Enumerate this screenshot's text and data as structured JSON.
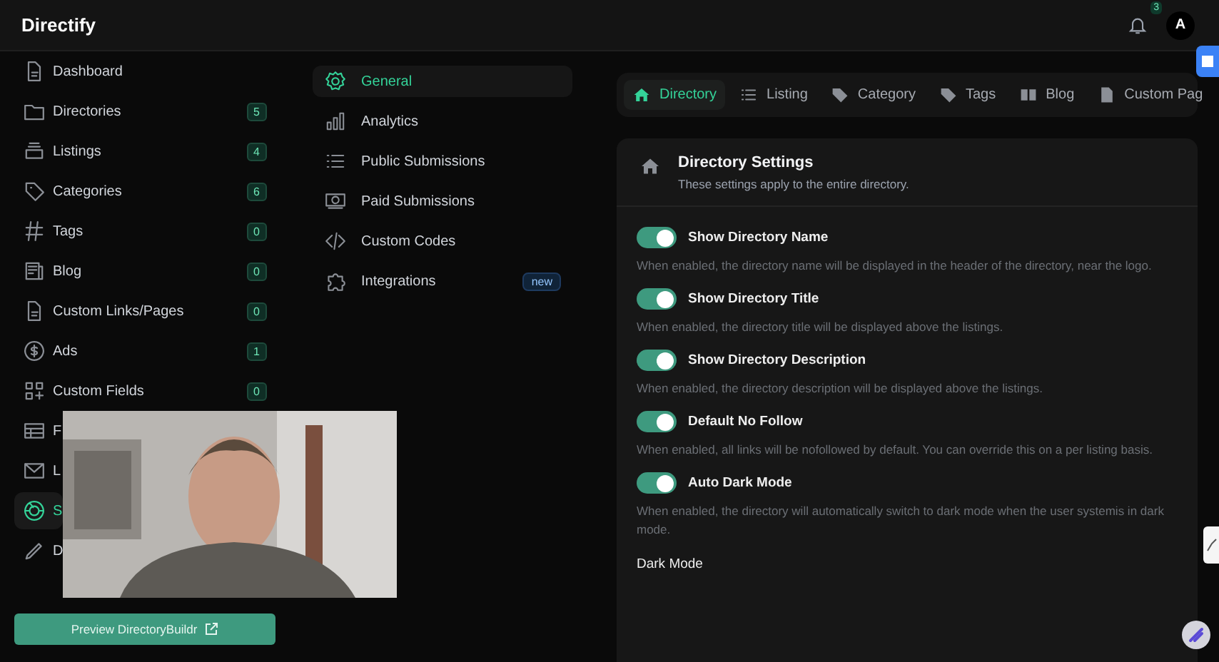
{
  "app": {
    "title": "Directify",
    "notifications": "3",
    "avatar": "A"
  },
  "sidebar": {
    "items": [
      {
        "label": "Dashboard",
        "selected": false
      },
      {
        "label": "Directories",
        "count": "5",
        "selected": false
      },
      {
        "label": "Listings",
        "count": "4",
        "selected": false
      },
      {
        "label": "Categories",
        "count": "6",
        "selected": false
      },
      {
        "label": "Tags",
        "count": "0",
        "selected": false
      },
      {
        "label": "Blog",
        "count": "0",
        "selected": false
      },
      {
        "label": "Custom Links/Pages",
        "count": "0",
        "selected": false
      },
      {
        "label": "Ads",
        "count": "1",
        "selected": false
      },
      {
        "label": "Custom Fields",
        "count": "0",
        "selected": false
      },
      {
        "label": "F",
        "selected": false
      },
      {
        "label": "L",
        "selected": false
      },
      {
        "label": "S",
        "selected": true
      },
      {
        "label": "D",
        "selected": false
      }
    ],
    "preview_button": "Preview DirectoryBuildr"
  },
  "settings_menu": [
    {
      "label": "General",
      "selected": true
    },
    {
      "label": "Analytics",
      "selected": false
    },
    {
      "label": "Public Submissions",
      "selected": false
    },
    {
      "label": "Paid Submissions",
      "selected": false
    },
    {
      "label": "Custom Codes",
      "selected": false
    },
    {
      "label": "Integrations",
      "badge": "new",
      "selected": false
    }
  ],
  "tabs": [
    {
      "label": "Directory",
      "selected": true
    },
    {
      "label": "Listing",
      "selected": false
    },
    {
      "label": "Category",
      "selected": false
    },
    {
      "label": "Tags",
      "selected": false
    },
    {
      "label": "Blog",
      "selected": false
    },
    {
      "label": "Custom Pag",
      "selected": false
    }
  ],
  "panel": {
    "title": "Directory Settings",
    "subtitle": "These settings apply to the entire directory.",
    "settings": [
      {
        "label": "Show Directory Name",
        "on": true,
        "description": "When enabled, the directory name will be displayed in the header of the directory, near the logo."
      },
      {
        "label": "Show Directory Title",
        "on": true,
        "description": "When enabled, the directory title will be displayed above the listings."
      },
      {
        "label": "Show Directory Description",
        "on": true,
        "description": "When enabled, the directory description will be displayed above the listings."
      },
      {
        "label": "Default No Follow",
        "on": true,
        "description": "When enabled, all links will be nofollowed by default. You can override this on a per listing basis."
      },
      {
        "label": "Auto Dark Mode",
        "on": true,
        "description": "When enabled, the directory will automatically switch to dark mode when the user systemis in dark mode."
      }
    ],
    "next_section": "Dark Mode"
  }
}
